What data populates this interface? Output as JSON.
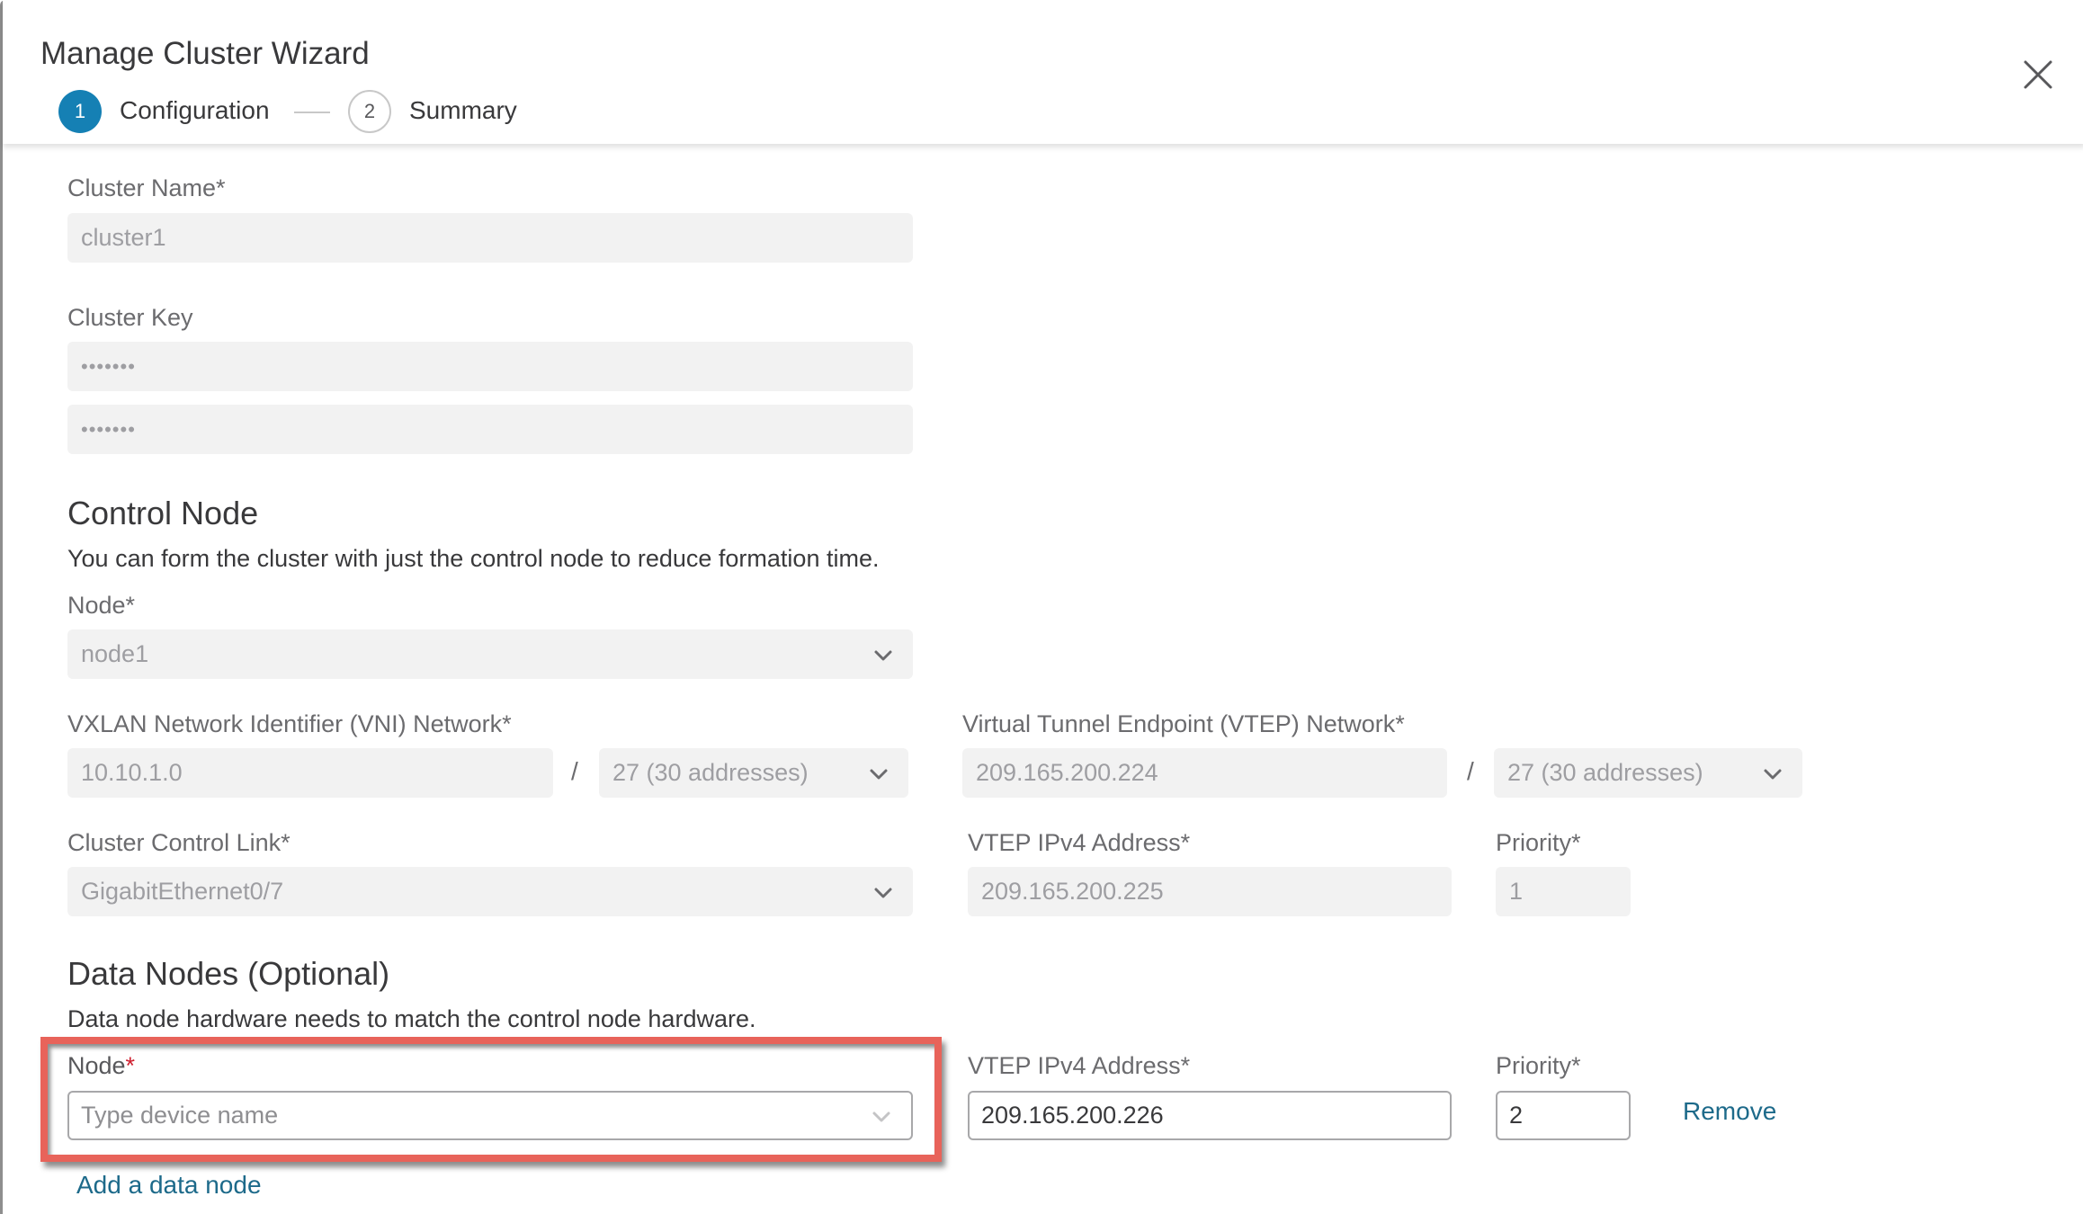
{
  "wizard": {
    "title": "Manage Cluster Wizard",
    "close_icon": "close-icon",
    "steps": [
      {
        "number": "1",
        "label": "Configuration",
        "state": "active"
      },
      {
        "number": "2",
        "label": "Summary",
        "state": "inactive"
      }
    ]
  },
  "cluster": {
    "name_label": "Cluster Name*",
    "name_value": "cluster1",
    "key_label": "Cluster Key",
    "key_value": "•••••••",
    "key_confirm_value": "•••••••"
  },
  "control_node": {
    "heading": "Control Node",
    "description": "You can form the cluster with just the control node to reduce formation time.",
    "node_label": "Node*",
    "node_value": "node1",
    "vni_label": "VXLAN Network Identifier (VNI) Network*",
    "vni_network": "10.10.1.0",
    "vni_prefix": "27 (30 addresses)",
    "vtep_network_label": "Virtual Tunnel Endpoint (VTEP) Network*",
    "vtep_network": "209.165.200.224",
    "vtep_prefix": "27 (30 addresses)",
    "separator": "/",
    "ccl_label": "Cluster Control Link*",
    "ccl_value": "GigabitEthernet0/7",
    "vtep_ip_label": "VTEP IPv4 Address*",
    "vtep_ip_value": "209.165.200.225",
    "priority_label": "Priority*",
    "priority_value": "1"
  },
  "data_nodes": {
    "heading": "Data Nodes (Optional)",
    "description": "Data node hardware needs to match the control node hardware.",
    "nodes": [
      {
        "node_label": "Node",
        "node_required_mark": "*",
        "node_placeholder": "Type device name",
        "vtep_ip_label": "VTEP IPv4 Address*",
        "vtep_ip_value": "209.165.200.226",
        "priority_label": "Priority*",
        "priority_value": "2",
        "remove_label": "Remove"
      }
    ],
    "add_label": "Add a data node"
  },
  "colors": {
    "accent": "#1580b4",
    "link": "#1d6a8a",
    "required": "#cf2030",
    "highlight": "#e8635a",
    "disabled_field": "#f2f2f2"
  }
}
